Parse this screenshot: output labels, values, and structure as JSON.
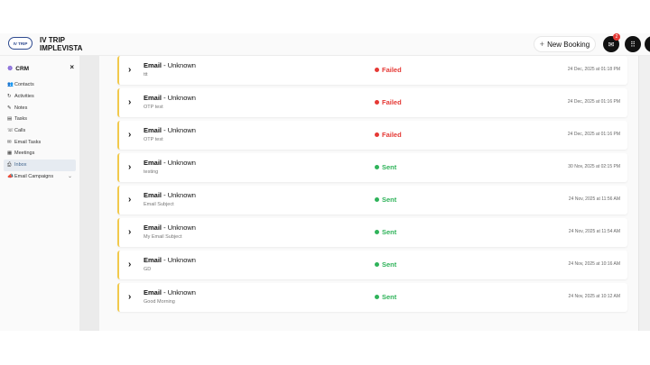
{
  "header": {
    "logo_text": "IV TRIP",
    "brand_line1": "IV TRIP",
    "brand_line2": "IMPLEVISTA",
    "new_booking_label": "New Booking",
    "new_booking_icon": "plus-icon",
    "mail_badge": "2",
    "icons": [
      "mail-icon",
      "apps-grid-icon",
      "profile-icon"
    ]
  },
  "sidebar": {
    "title": "CRM",
    "close_symbol": "×",
    "items": [
      {
        "label": "Contacts",
        "icon": "contacts-icon"
      },
      {
        "label": "Activities",
        "icon": "activities-icon"
      },
      {
        "label": "Notes",
        "icon": "notes-icon"
      },
      {
        "label": "Tasks",
        "icon": "tasks-icon"
      },
      {
        "label": "Calls",
        "icon": "phone-icon"
      },
      {
        "label": "Email Tasks",
        "icon": "email-icon"
      },
      {
        "label": "Meetings",
        "icon": "calendar-icon"
      },
      {
        "label": "Inbox",
        "icon": "inbox-icon",
        "active": true
      },
      {
        "label": "Email Campaigns",
        "icon": "megaphone-icon",
        "expandable": true
      }
    ]
  },
  "colors": {
    "failed": "#e53935",
    "sent": "#2fb35a",
    "accent_border": "#f2c94c"
  },
  "emails": [
    {
      "type": "Email",
      "sender": "Unknown",
      "subject": "ttt",
      "status": "Failed",
      "date": "24 Dec, 2025 at 01:18 PM"
    },
    {
      "type": "Email",
      "sender": "Unknown",
      "subject": "OTP test",
      "status": "Failed",
      "date": "24 Dec, 2025 at 01:16 PM"
    },
    {
      "type": "Email",
      "sender": "Unknown",
      "subject": "OTP test",
      "status": "Failed",
      "date": "24 Dec, 2025 at 01:16 PM"
    },
    {
      "type": "Email",
      "sender": "Unknown",
      "subject": "testing",
      "status": "Sent",
      "date": "30 Nov, 2025 at 02:15 PM"
    },
    {
      "type": "Email",
      "sender": "Unknown",
      "subject": "Email Subject",
      "status": "Sent",
      "date": "24 Nov, 2025 at 11:56 AM"
    },
    {
      "type": "Email",
      "sender": "Unknown",
      "subject": "My Email Subject",
      "status": "Sent",
      "date": "24 Nov, 2025 at 11:54 AM"
    },
    {
      "type": "Email",
      "sender": "Unknown",
      "subject": "GD",
      "status": "Sent",
      "date": "24 Nov, 2025 at 10:16 AM"
    },
    {
      "type": "Email",
      "sender": "Unknown",
      "subject": "Good Morning",
      "status": "Sent",
      "date": "24 Nov, 2025 at 10:12 AM"
    }
  ]
}
